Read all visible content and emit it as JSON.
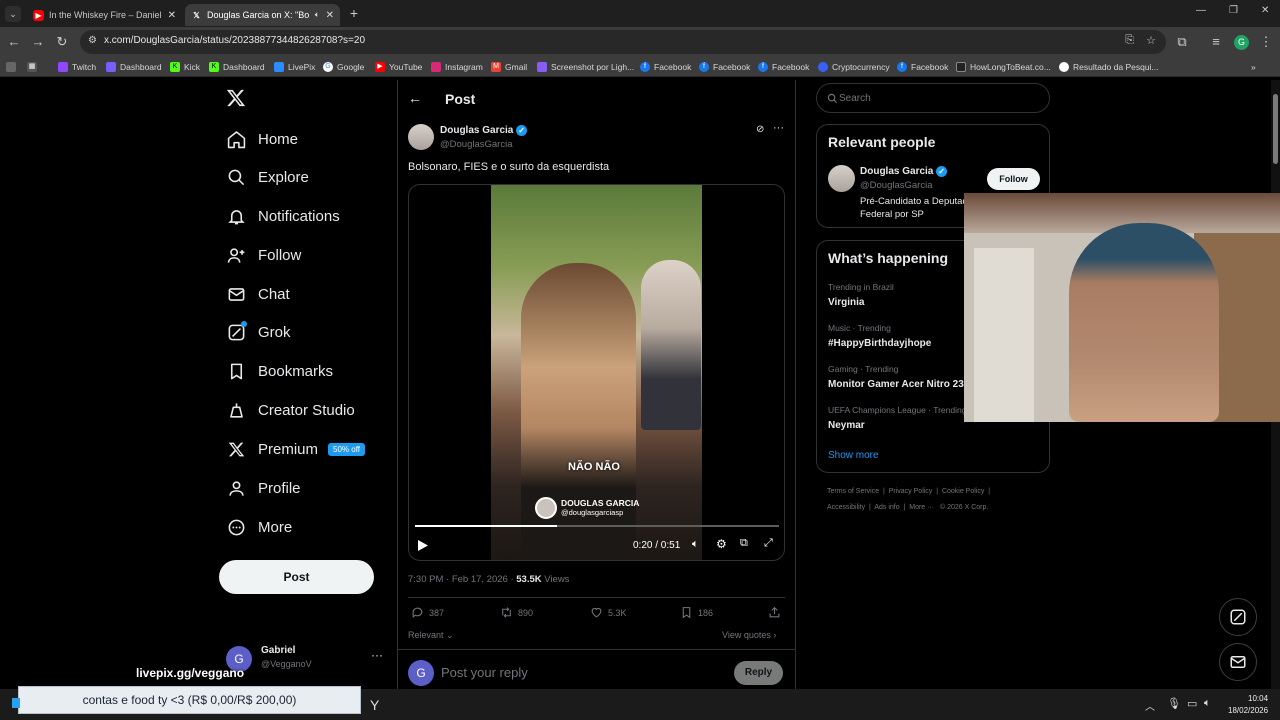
{
  "browser": {
    "tabs": [
      {
        "title": "In the Whiskey Fire – Daniele G",
        "icon": "youtube-icon",
        "active": false
      },
      {
        "title": "Douglas Garcia on X: \"Bolso",
        "icon": "x-logo-icon",
        "active": true
      }
    ],
    "url": "x.com/DouglasGarcia/status/2023887734482628708?s=20",
    "bookmarks": [
      "Twitch",
      "Dashboard",
      "Kick",
      "Dashboard",
      "LivePix",
      "Google",
      "YouTube",
      "Instagram",
      "Gmail",
      "Screenshot por Ligh...",
      "Facebook",
      "Facebook",
      "Facebook",
      "Cryptocurrency",
      "Facebook",
      "HowLongToBeat.co...",
      "Resultado da Pesqui..."
    ]
  },
  "sidebar": {
    "items": [
      {
        "label": "Home",
        "icon": "home-icon"
      },
      {
        "label": "Explore",
        "icon": "search-icon"
      },
      {
        "label": "Notifications",
        "icon": "bell-icon"
      },
      {
        "label": "Follow",
        "icon": "person-add-icon"
      },
      {
        "label": "Chat",
        "icon": "mail-icon"
      },
      {
        "label": "Grok",
        "icon": "grok-icon"
      },
      {
        "label": "Bookmarks",
        "icon": "bookmark-icon"
      },
      {
        "label": "Creator Studio",
        "icon": "creator-studio-icon"
      },
      {
        "label": "Premium",
        "icon": "x-logo-icon"
      },
      {
        "label": "Profile",
        "icon": "person-icon"
      },
      {
        "label": "More",
        "icon": "more-circle-icon"
      }
    ],
    "premium_badge": "50% off",
    "post_button": "Post",
    "account": {
      "name": "Gabriel",
      "handle": "@VegganoV",
      "initial": "G"
    }
  },
  "post": {
    "header_title": "Post",
    "author_name": "Douglas Garcia",
    "author_handle": "@DouglasGarcia",
    "text": "Bolsonaro, FIES e o surto da esquerdista",
    "video": {
      "caption": "NÃO NÃO",
      "watermark_name": "DOUGLAS GARCIA",
      "watermark_handle": "@douglasgarciasp",
      "time": "0:20 / 0:51",
      "progress": 0.39
    },
    "timestamp": "7:30 PM · Feb 17, 2026 · ",
    "views_count": "53.5K",
    "views_label": " Views",
    "actions": {
      "replies": "387",
      "reposts": "890",
      "likes": "5.3K",
      "bookmarks": "186"
    },
    "sort_label": "Relevant",
    "view_quotes": "View quotes",
    "reply_placeholder": "Post your reply",
    "reply_button": "Reply",
    "reply_avatar_initial": "G"
  },
  "right": {
    "search_placeholder": "Search",
    "relevant_title": "Relevant people",
    "person": {
      "name": "Douglas Garcia",
      "handle": "@DouglasGarcia",
      "bio": "Pré-Candidato a Deputado Federal por SP",
      "follow": "Follow"
    },
    "happening_title": "What’s happening",
    "trends": [
      {
        "category": "Trending in Brazil",
        "name": "Virginia"
      },
      {
        "category": "Music · Trending",
        "name": "#HappyBirthdayjhope"
      },
      {
        "category": "Gaming · Trending",
        "name": "Monitor Gamer Acer Nitro 23"
      },
      {
        "category": "UEFA Champions League · Trending",
        "name": "Neymar"
      }
    ],
    "show_more": "Show more",
    "footer_row1": [
      "Terms of Service",
      "Privacy Policy",
      "Cookie Policy"
    ],
    "footer_row2": [
      "Accessibility",
      "Ads info",
      "More ···",
      "© 2026 X Corp."
    ]
  },
  "overlay": {
    "livepix": "livepix.gg/veggano",
    "goal": "contas e food ty <3 (R$ 0,00/R$ 200,00)"
  },
  "taskbar": {
    "time": "10:04",
    "date": "18/02/2026"
  },
  "colors": {
    "accent": "#1d9bf0",
    "bg": "#000000",
    "border": "#2f3336",
    "muted": "#71767b"
  }
}
